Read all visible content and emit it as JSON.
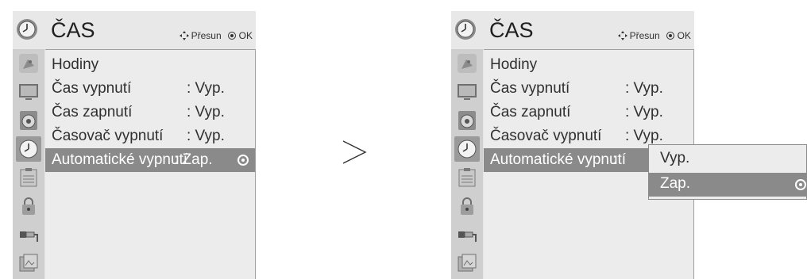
{
  "screen_left": {
    "title": "ČAS",
    "hint_move": "Přesun",
    "hint_ok": "OK",
    "rows": [
      {
        "label": "Hodiny",
        "value": ""
      },
      {
        "label": "Čas vypnutí",
        "value": ": Vyp."
      },
      {
        "label": "Čas zapnutí",
        "value": ": Vyp."
      },
      {
        "label": "Časovač vypnutí",
        "value": ": Vyp."
      },
      {
        "label": "Automatické vypnutí",
        "value": ": Zap."
      }
    ]
  },
  "screen_right": {
    "title": "ČAS",
    "hint_move": "Přesun",
    "hint_ok": "OK",
    "rows": [
      {
        "label": "Hodiny",
        "value": ""
      },
      {
        "label": "Čas vypnutí",
        "value": ": Vyp."
      },
      {
        "label": "Čas zapnutí",
        "value": ": Vyp."
      },
      {
        "label": "Časovač vypnutí",
        "value": ": Vyp."
      },
      {
        "label": "Automatické vypnutí",
        "value": ":"
      }
    ],
    "popup_options": [
      "Vyp.",
      "Zap."
    ],
    "popup_selected": "Zap."
  },
  "sidebar_icons": [
    "satellite-icon",
    "tv-picture-icon",
    "speaker-icon",
    "clock-icon",
    "option-icon",
    "lock-icon",
    "input-plug-icon",
    "usb-photo-icon"
  ],
  "active_category": "clock-icon",
  "colors": {
    "panel": "#e6e6e6",
    "sidebar": "#cfcfcf",
    "highlight": "#8a8a8a"
  }
}
